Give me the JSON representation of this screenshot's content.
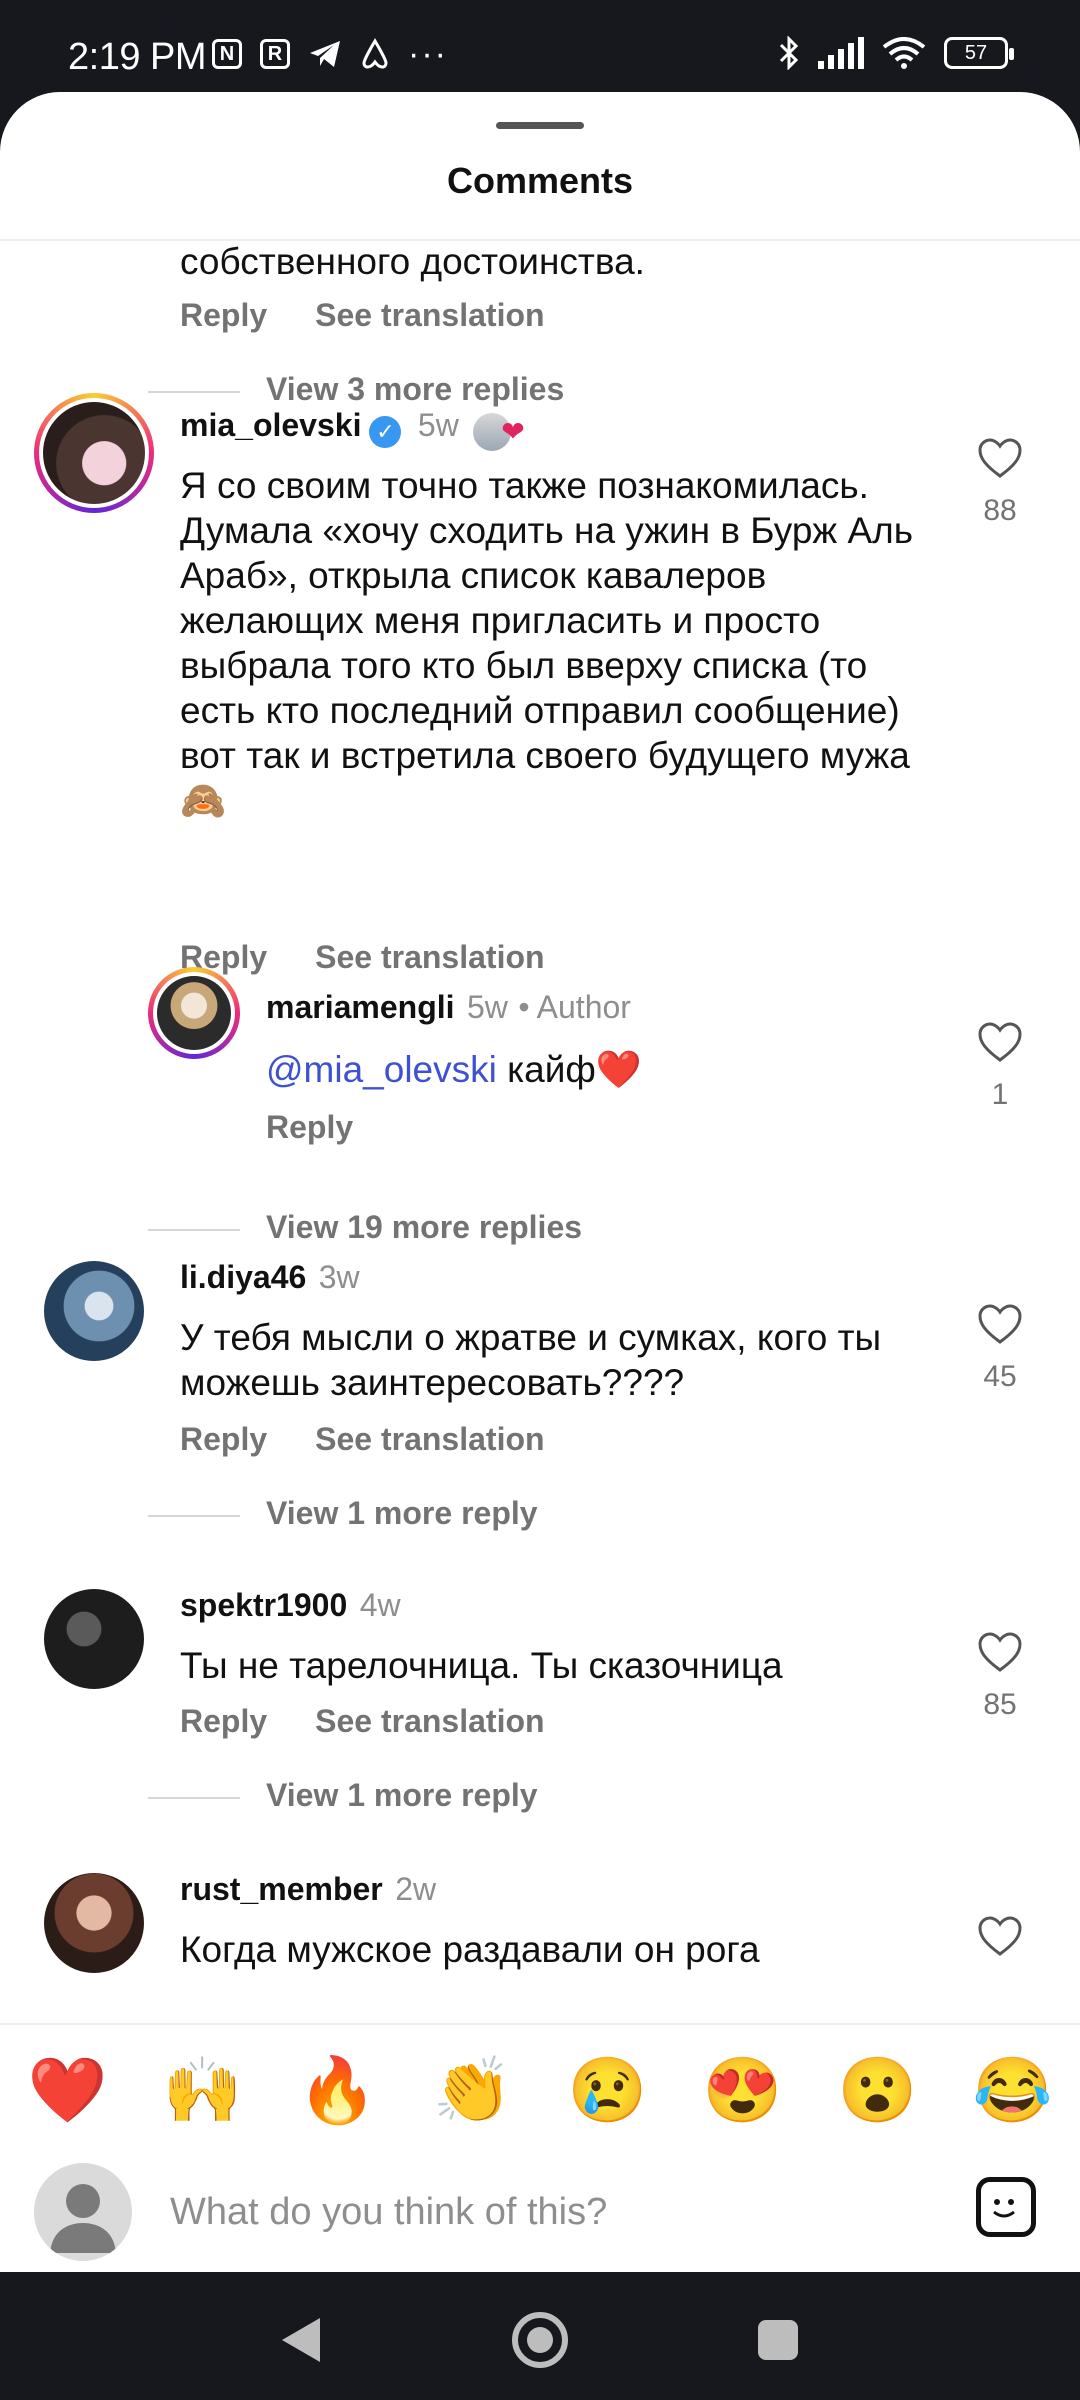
{
  "status_bar": {
    "time": "2:19 PM",
    "app_icons": [
      "n-badge-icon",
      "r-badge-icon",
      "telegram-icon",
      "airbnb-icon",
      "more-dots-icon"
    ],
    "battery": "57",
    "system_icons": [
      "bluetooth-icon",
      "signal-icon",
      "wifi-icon",
      "battery-icon"
    ]
  },
  "sheet": {
    "title": "Comments"
  },
  "actions": {
    "reply": "Reply",
    "see_translation": "See translation"
  },
  "top_partial": {
    "text": "собственного достоинства.",
    "view_more": "View 3 more replies"
  },
  "comments": [
    {
      "username": "mia_olevski",
      "time": "5w",
      "verified": true,
      "text": "Я со своим точно также познакомилась. Думала «хочу сходить на ужин в Бурж Аль Араб», открыла список кавалеров желающих меня пригласить и просто выбрала того кто был вверху списка (то есть кто последний отправил сообщение) вот так и встретила своего будущего мужа 🙈",
      "likes": "88"
    },
    {
      "username": "li.diya46",
      "time": "3w",
      "text": "У тебя  мысли о жратве и сумках, кого ты можешь заинтересовать????",
      "likes": "45",
      "view_more": "View 1 more reply"
    },
    {
      "username": "spektr1900",
      "time": "4w",
      "text": "Ты не тарелочница. Ты сказочница",
      "likes": "85",
      "view_more": "View 1 more reply"
    },
    {
      "username": "rust_member",
      "time": "2w",
      "text": "Когда мужское раздавали он рога"
    }
  ],
  "reply_thread": {
    "username": "mariamengli",
    "time": "5w",
    "author_tag": "• Author",
    "mention": "@mia_olevski",
    "text": " кайф❤️",
    "likes": "1",
    "view_more": "View 19 more replies"
  },
  "emoji_bar": [
    "❤️",
    "🙌",
    "🔥",
    "👏",
    "😢",
    "😍",
    "😮",
    "😂"
  ],
  "input": {
    "placeholder": "What do you think of this?"
  },
  "colors": {
    "status_bar_bg": "#17181d",
    "verified": "#3897f0",
    "mention": "#3f51d1",
    "muted_text": "#737373"
  }
}
